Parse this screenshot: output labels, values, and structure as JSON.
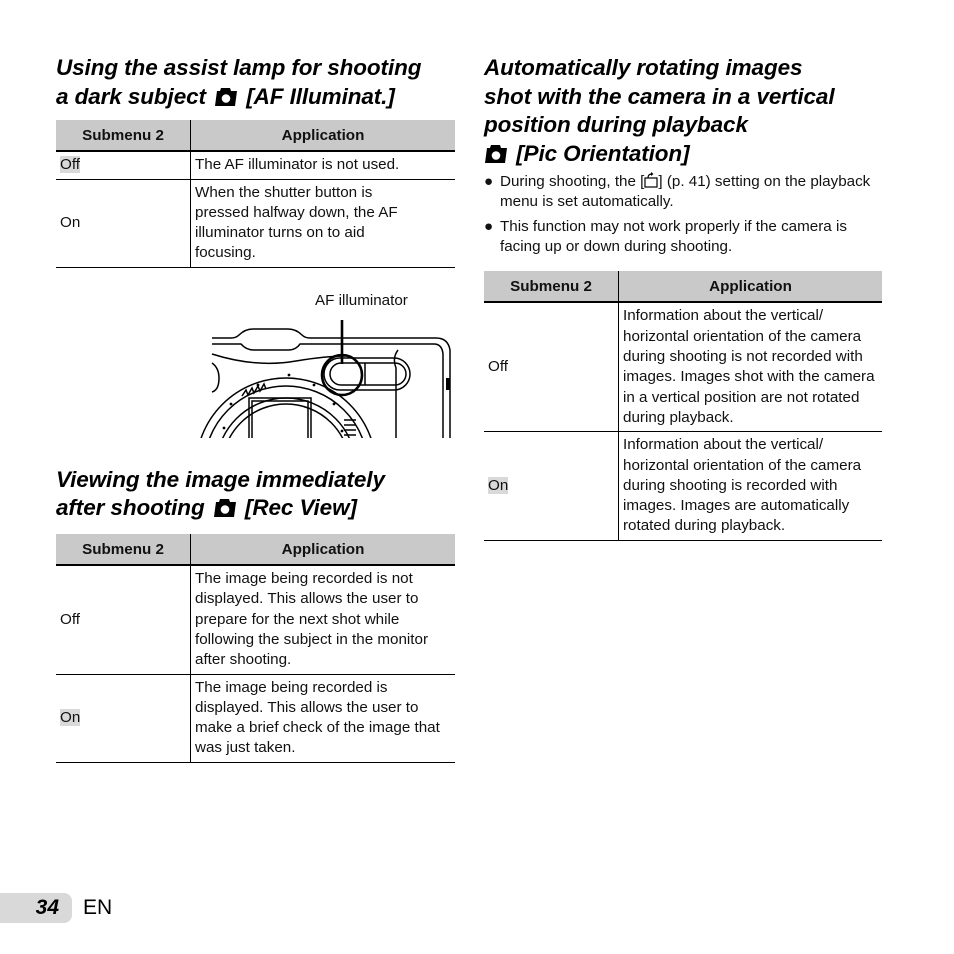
{
  "page": {
    "number": "34",
    "language": "EN"
  },
  "sections": {
    "af_illuminat": {
      "title_line1": "Using the assist lamp for shooting",
      "title_line2_pre": "a dark subject",
      "title_icon": "camera-icon",
      "title_line2_post": "[AF Illuminat.]",
      "table": {
        "headers": [
          "Submenu 2",
          "Application"
        ],
        "rows": [
          {
            "option": "Off",
            "highlighted": true,
            "application": "The AF illuminator is not used."
          },
          {
            "option": "On",
            "highlighted": false,
            "application": "When the shutter button is pressed halfway down, the AF illuminator turns on to aid focusing."
          }
        ]
      },
      "figure": {
        "label": "AF illuminator",
        "subject": "camera-front-illustration"
      }
    },
    "rec_view": {
      "title_line1": "Viewing the image immediately",
      "title_line2_pre": "after shooting",
      "title_icon": "camera-icon",
      "title_line2_post": "[Rec View]",
      "table": {
        "headers": [
          "Submenu 2",
          "Application"
        ],
        "rows": [
          {
            "option": "Off",
            "highlighted": false,
            "application": "The image being recorded is not displayed. This allows the user to prepare for the next shot while following the subject in the monitor after shooting."
          },
          {
            "option": "On",
            "highlighted": true,
            "application": "The image being recorded is displayed. This allows the user to make a brief check of the image that was just taken."
          }
        ]
      }
    },
    "pic_orientation": {
      "title_line1": "Automatically rotating images",
      "title_line2": "shot with the camera in a vertical",
      "title_line3": "position during playback",
      "title_icon": "camera-icon",
      "title_line4_post": "[Pic Orientation]",
      "bullets": [
        {
          "pre": "During shooting, the [",
          "icon": "rotate-icon",
          "post": "] (p. 41) setting on the playback menu is set automatically."
        },
        {
          "text": "This function may not work properly if the camera is facing up or down during shooting."
        }
      ],
      "bullet_glyph": "●",
      "table": {
        "headers": [
          "Submenu 2",
          "Application"
        ],
        "rows": [
          {
            "option": "Off",
            "highlighted": false,
            "application": "Information about the vertical/ horizontal orientation of the camera during shooting is not recorded with images. Images shot with the camera in a vertical position are not rotated during playback."
          },
          {
            "option": "On",
            "highlighted": true,
            "application": "Information about the vertical/ horizontal orientation of the camera during shooting is recorded with images. Images are automatically rotated during playback."
          }
        ]
      }
    }
  },
  "colors": {
    "header_bg": "#c9c9c9",
    "highlight_bg": "#d9d9d9",
    "text": "#111111"
  }
}
